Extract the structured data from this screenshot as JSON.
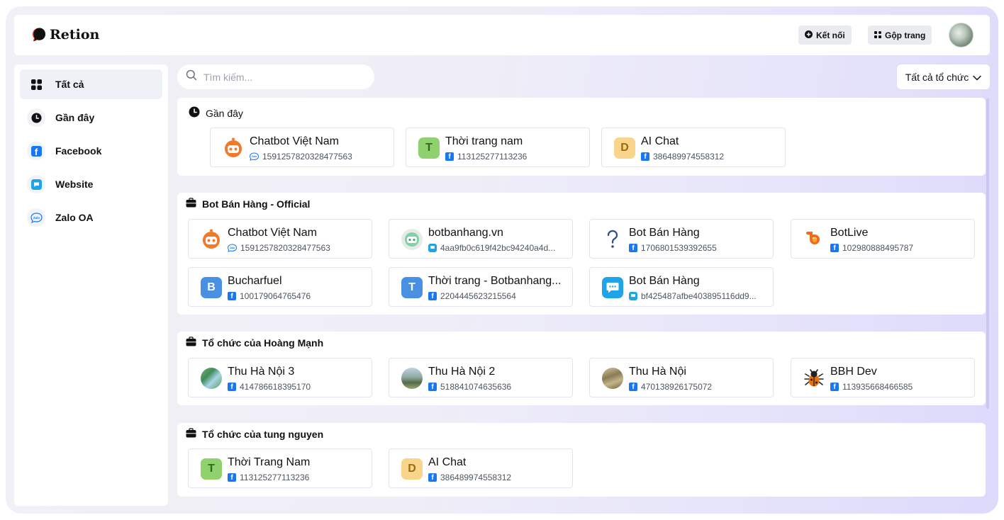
{
  "app": {
    "name": "Retion"
  },
  "header": {
    "connect_label": "Kết nối",
    "merge_label": "Gộp trang"
  },
  "sidebar": {
    "items": [
      {
        "label": "Tất cả",
        "icon": "grid-icon",
        "active": true
      },
      {
        "label": "Gần đây",
        "icon": "clock-icon"
      },
      {
        "label": "Facebook",
        "icon": "facebook-icon"
      },
      {
        "label": "Website",
        "icon": "website-chat-icon"
      },
      {
        "label": "Zalo OA",
        "icon": "zalo-icon"
      }
    ]
  },
  "search": {
    "placeholder": "Tìm kiếm..."
  },
  "org_filter": {
    "selected": "Tất cả tổ chức"
  },
  "sections": [
    {
      "title": "Gần đây",
      "icon": "clock-icon",
      "pages": [
        {
          "name": "Chatbot Việt Nam",
          "id": "1591257820328477563",
          "channel": "zalo",
          "avatar": "robot-orange"
        },
        {
          "name": "Thời trang nam",
          "id": "113125277113236",
          "channel": "facebook",
          "avatar": "letter",
          "letter": "T",
          "color": "#8fd16c"
        },
        {
          "name": "AI Chat",
          "id": "386489974558312",
          "channel": "facebook",
          "avatar": "letter",
          "letter": "D",
          "color": "#f8d58a"
        }
      ]
    },
    {
      "title": "Bot Bán Hàng - Official",
      "icon": "briefcase-icon",
      "pages": [
        {
          "name": "Chatbot Việt Nam",
          "id": "1591257820328477563",
          "channel": "zalo",
          "avatar": "robot-orange"
        },
        {
          "name": "botbanhang.vn",
          "id": "4aa9fb0c619f42bc94240a4d...",
          "channel": "website",
          "avatar": "robot-green"
        },
        {
          "name": "Bot Bán Hàng",
          "id": "1706801539392655",
          "channel": "facebook",
          "avatar": "question"
        },
        {
          "name": "BotLive",
          "id": "102980888495787",
          "channel": "facebook",
          "avatar": "botlive"
        },
        {
          "name": "Bucharfuel",
          "id": "100179064765476",
          "channel": "facebook",
          "avatar": "letter",
          "letter": "B",
          "color": "#4a90e2"
        },
        {
          "name": "Thời trang - Botbanhang...",
          "id": "2204445623215564",
          "channel": "facebook",
          "avatar": "letter",
          "letter": "T",
          "color": "#4a90e2"
        },
        {
          "name": "Bot Bán Hàng",
          "id": "bf425487afbe403895116dd9...",
          "channel": "website",
          "avatar": "chat-blue"
        }
      ]
    },
    {
      "title": "Tổ chức của Hoàng Mạnh",
      "icon": "briefcase-icon",
      "pages": [
        {
          "name": "Thu Hà Nội 3",
          "id": "414786618395170",
          "channel": "facebook",
          "avatar": "photo-1"
        },
        {
          "name": "Thu Hà Nội 2",
          "id": "518841074635636",
          "channel": "facebook",
          "avatar": "photo-2"
        },
        {
          "name": "Thu Hà Nội",
          "id": "470138926175072",
          "channel": "facebook",
          "avatar": "photo-3"
        },
        {
          "name": "BBH Dev",
          "id": "113935668466585",
          "channel": "facebook",
          "avatar": "bug"
        }
      ]
    },
    {
      "title": "Tổ chức của tung nguyen",
      "icon": "briefcase-icon",
      "pages": [
        {
          "name": "Thời Trang Nam",
          "id": "113125277113236",
          "channel": "facebook",
          "avatar": "letter",
          "letter": "T",
          "color": "#8fd16c"
        },
        {
          "name": "AI Chat",
          "id": "386489974558312",
          "channel": "facebook",
          "avatar": "letter",
          "letter": "D",
          "color": "#f8d58a"
        }
      ]
    }
  ]
}
